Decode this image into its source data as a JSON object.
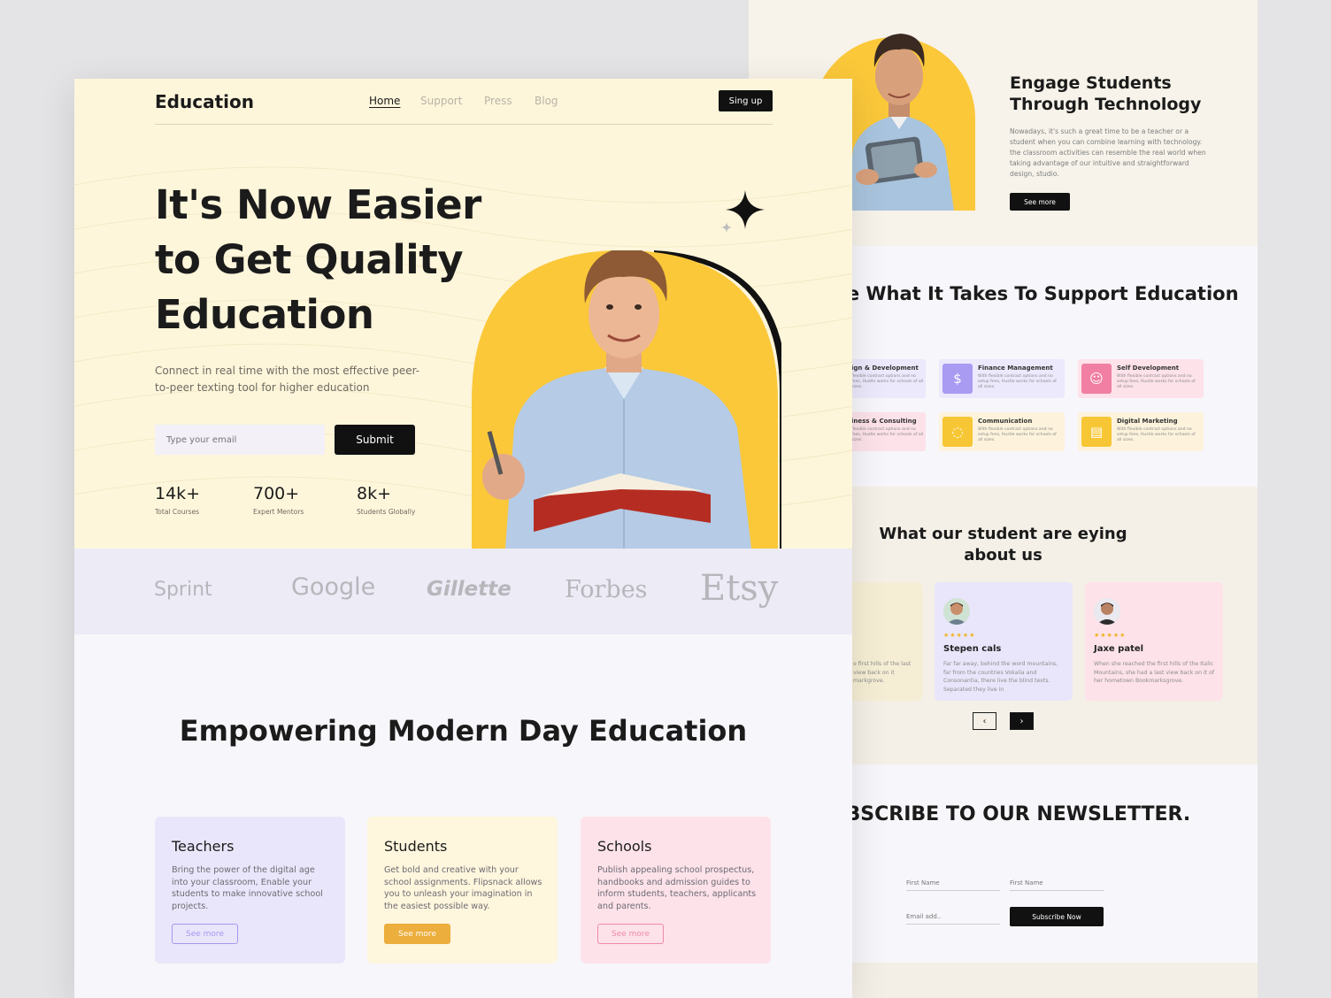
{
  "back": {
    "engage": {
      "title": "Engage Students Through Technology",
      "text": "Nowadays, it's such a great time to be a teacher or a student when you can combine learning with technology. the classroom activities can resemble the real world when taking advantage of our intuitive and straightforward design, studio.",
      "button": "See more"
    },
    "support": {
      "title": "We Have What It Takes To Support Education",
      "services": [
        {
          "title": "ign & Development",
          "text": "flexible contract options and no fees, Hustle works for schools of all sizes."
        },
        {
          "title": "Finance Management",
          "text": "With flexible contract options and no setup fees, Hustle works for schools of all sizes."
        },
        {
          "title": "Self Development",
          "text": "With flexible contract options and no setup fees, Hustle works for schools of all sizes."
        },
        {
          "title": "iness & Consulting",
          "text": "flexible contract options and no fees, Hustle works for schools of all sizes."
        },
        {
          "title": "Communication",
          "text": "With flexible contract options and no setup fees, Hustle works for schools of all sizes."
        },
        {
          "title": "Digital Marketing",
          "text": "With flexible contract options and no setup fees, Hustle works for schools of all sizes."
        }
      ],
      "colors": {
        "purple": "#ece9fd",
        "pink": "#fde4ec",
        "yellow": "#fdf3dc"
      }
    },
    "testimonials": {
      "title": "What our student are eying about us",
      "items": [
        {
          "name": "",
          "stars": "",
          "text": "e first hills of the last view back on it markgrove."
        },
        {
          "name": "Stepen cals",
          "stars": "★★★★★",
          "text": "Far far away, behind the word mountains, far from the countries Vokalia and Consonantia, there live the blind texts. Separated they live in"
        },
        {
          "name": "Jaxe patel",
          "stars": "★★★★★",
          "text": "When she reached the first hills of the Italic Mountains, she had a last view back on it of her hometown Bookmarksgrove."
        }
      ],
      "prev": "‹",
      "next": "›"
    },
    "newsletter": {
      "title": "SUBSCRIBE TO OUR NEWSLETTER.",
      "first_name_a": "First Name",
      "first_name_b": "First Name",
      "email": "Email add..",
      "button": "Subscribe Now"
    }
  },
  "front": {
    "nav": {
      "logo": "Education",
      "links": [
        "Home",
        "Support",
        "Press",
        "Blog"
      ],
      "active": "Home",
      "signup": "Sing up"
    },
    "hero": {
      "title": "It's Now Easier to Get Quality Education",
      "subtitle": "Connect in real time with the most effective peer-to-peer texting tool for higher education",
      "email_placeholder": "Type your email",
      "submit": "Submit",
      "stats": [
        {
          "value": "14k+",
          "label": "Total Courses"
        },
        {
          "value": "700+",
          "label": "Expert Mentors"
        },
        {
          "value": "8k+",
          "label": "Students Globally"
        }
      ],
      "accent": "#fbc83a"
    },
    "logos": [
      "Sprint",
      "Google",
      "Gillette",
      "Forbes",
      "Etsy"
    ],
    "empower": {
      "title": "Empowering Modern Day Education",
      "cards": [
        {
          "title": "Teachers",
          "text": "Bring the power of the digital age into your classroom, Enable your students to make innovative school projects.",
          "button": "See more",
          "bg": "#e9e6fb"
        },
        {
          "title": "Students",
          "text": "Get bold and creative with your school assignments. Flipsnack allows you to unleash your imagination in the easiest possible way.",
          "button": "See more",
          "bg": "#fef6dd"
        },
        {
          "title": "Schools",
          "text": "Publish appealing school prospectus, handbooks and admission guides to inform students, teachers, applicants and parents.",
          "button": "See more",
          "bg": "#fde2ea"
        }
      ]
    }
  }
}
